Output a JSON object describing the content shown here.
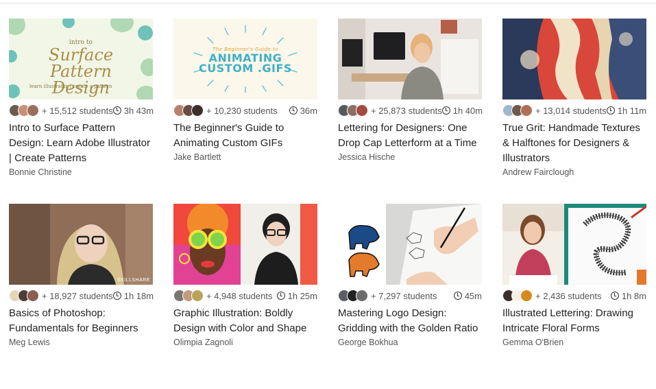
{
  "courses": [
    {
      "title": "Intro to Surface Pattern Design: Learn Adobe Illustrator | Create Patterns",
      "author": "Bonnie Christine",
      "students": "+ 15,512 students",
      "duration": "3h 43m",
      "avatar_colors": [
        "#6b5a4e",
        "#c98f74",
        "#9b6f5e"
      ],
      "thumb": {
        "line1": "intro to",
        "line2": "Surface Pattern Design",
        "line3": "learn illustrator | create a pattern"
      }
    },
    {
      "title": "The Beginner's Guide to Animating Custom GIFs",
      "author": "Jake Bartlett",
      "students": "+ 10,230 students",
      "duration": "36m",
      "avatar_colors": [
        "#b7826d",
        "#6a4d42",
        "#3d2f2b"
      ],
      "thumb": {
        "line1": "The Beginner's Guide to",
        "line2": "ANIMATING CUSTOM .GIFS"
      }
    },
    {
      "title": "Lettering for Designers: One Drop Cap Letterform at a Time",
      "author": "Jessica Hische",
      "students": "+ 25,873 students",
      "duration": "1h 40m",
      "avatar_colors": [
        "#555a5f",
        "#8c6e62",
        "#a34b3e"
      ]
    },
    {
      "title": "True Grit: Handmade Textures & Halftones for Designers & Illustrators",
      "author": "Andrew Fairclough",
      "students": "+ 13,014 students",
      "duration": "1h 11m",
      "avatar_colors": [
        "#9fb7cf",
        "#6e5b4d",
        "#b06e57"
      ]
    },
    {
      "title": "Basics of Photoshop: Fundamentals for Beginners",
      "author": "Meg Lewis",
      "students": "+ 18,927 students",
      "duration": "1h 18m",
      "avatar_colors": [
        "#e6d6b8",
        "#4d3d36",
        "#8b5f52"
      ],
      "thumb": {
        "watermark": "SKILLSHARE"
      }
    },
    {
      "title": "Graphic Illustration: Boldly Design with Color and Shape",
      "author": "Olimpia Zagnoli",
      "students": "+ 4,948 students",
      "duration": "1h 25m",
      "avatar_colors": [
        "#7a7572",
        "#c29a7e",
        "#b9a45a"
      ]
    },
    {
      "title": "Mastering Logo Design: Gridding with the Golden Ratio",
      "author": "George Bokhua",
      "students": "+ 7,297 students",
      "duration": "45m",
      "avatar_colors": [
        "#5a5e63",
        "#222222",
        "#6d6d6d"
      ]
    },
    {
      "title": "Illustrated Lettering: Drawing Intricate Floral Forms",
      "author": "Gemma O'Brien",
      "students": "+ 2,436 students",
      "duration": "1h 8m",
      "avatar_colors": [
        "#3b2f2c",
        "#f5f0e8",
        "#d78a1e"
      ]
    }
  ]
}
